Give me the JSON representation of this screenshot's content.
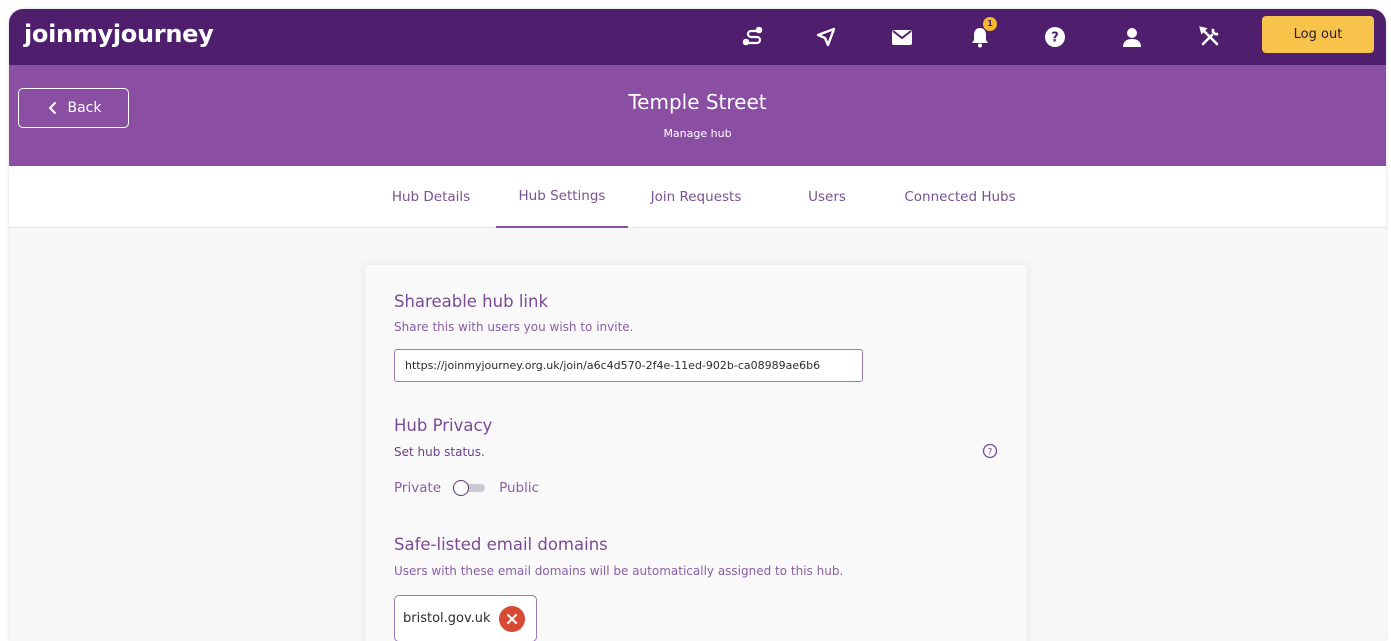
{
  "app": {
    "brand": "joinmyjourney",
    "logout_label": "Log out",
    "notification_count": "1"
  },
  "nav_icons": [
    "journey-icon",
    "send-icon",
    "mail-icon",
    "bell-icon",
    "help-icon",
    "user-icon",
    "tools-icon"
  ],
  "header": {
    "back_label": "Back",
    "title": "Temple Street",
    "subtitle": "Manage hub"
  },
  "tabs": [
    {
      "label": "Hub Details",
      "active": false
    },
    {
      "label": "Hub Settings",
      "active": true
    },
    {
      "label": "Join Requests",
      "active": false
    },
    {
      "label": "Users",
      "active": false
    },
    {
      "label": "Connected Hubs",
      "active": false
    }
  ],
  "shareable": {
    "title": "Shareable hub link",
    "description": "Share this with users you wish to invite.",
    "link": "https://joinmyjourney.org.uk/join/a6c4d570-2f4e-11ed-902b-ca08989ae6b6"
  },
  "privacy": {
    "title": "Hub Privacy",
    "description": "Set hub status.",
    "private_label": "Private",
    "public_label": "Public"
  },
  "domains": {
    "title": "Safe-listed email domains",
    "description": "Users with these email domains will be automatically assigned to this hub.",
    "items": [
      "bristol.gov.uk"
    ]
  },
  "colors": {
    "nav_bg": "#4f1f6e",
    "header_bg": "#8a4ea3",
    "logout_bg": "#f7c34a",
    "remove_red": "#d94a35"
  }
}
